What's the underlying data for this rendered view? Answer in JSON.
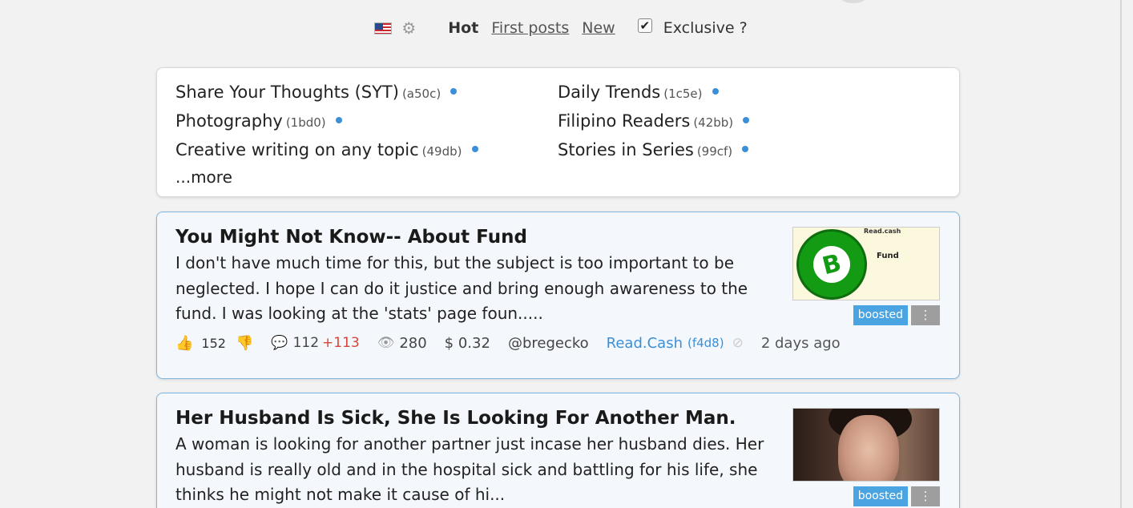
{
  "topbar": {
    "flag_icon": "us-flag-icon",
    "settings_icon": "gear-icon",
    "sort_hot": "Hot",
    "sort_first_posts": "First posts",
    "sort_new": "New",
    "exclusive_checked": true,
    "exclusive_label": "Exclusive ?"
  },
  "topics": {
    "items": [
      {
        "name": "Share Your Thoughts (SYT)",
        "code": "(a50c)"
      },
      {
        "name": "Daily Trends",
        "code": "(1c5e)"
      },
      {
        "name": "Photography",
        "code": "(1bd0)"
      },
      {
        "name": "Filipino Readers",
        "code": "(42bb)"
      },
      {
        "name": "Creative writing on any topic",
        "code": "(49db)"
      },
      {
        "name": "Stories in Series",
        "code": "(99cf)"
      }
    ],
    "more_label": "...more"
  },
  "posts": [
    {
      "title": "You Might Not Know-- About Fund",
      "excerpt": "I don't have much time for this, but the subject is too important to be neglected. I hope I can do it justice and bring enough awareness to the fund. I was looking at the 'stats' page foun.....",
      "thumb_text_small": "Read.cash",
      "thumb_text": "Fund",
      "thumb_symbol": "B",
      "boosted_label": "boosted",
      "menu_label": "⋮",
      "upvotes": "152",
      "comments": "112",
      "new_comments": "+113",
      "views": "280",
      "earnings": "$ 0.32",
      "author": "@bregecko",
      "community": "Read.Cash",
      "community_code": "(f4d8)",
      "time": "2 days ago"
    },
    {
      "title": "Her Husband Is Sick, She Is Looking For Another Man.",
      "excerpt": "A woman is looking for another partner just incase her husband dies. Her husband is really old and in the hospital sick and battling for his life, she thinks he might not make it cause of hi...",
      "boosted_label": "boosted",
      "menu_label": "⋮"
    }
  ],
  "colors": {
    "accent": "#3b8fd8",
    "boosted": "#4aa4e2",
    "new_comments": "#d9443a",
    "post_border": "#7fb6e0"
  }
}
